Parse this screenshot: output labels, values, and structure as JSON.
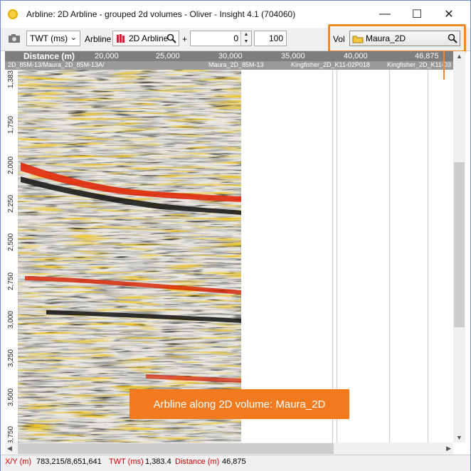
{
  "window": {
    "title": "Arbline: 2D Arbline - grouped 2d volumes - Oliver - Insight 4.1 (704060)",
    "minimize_glyph": "—",
    "maximize_glyph": "☐",
    "close_glyph": "✕"
  },
  "toolbar": {
    "domain_select": "TWT (ms)",
    "arbline_label": "Arbline",
    "arbline_value": "2D Arbline",
    "plus_label": "+",
    "offset_value": "0",
    "scale_value": "100",
    "vol_label": "Vol",
    "vol_value": "Maura_2D"
  },
  "axis": {
    "title": "Distance (m)",
    "ticks": [
      "20,000",
      "25,000",
      "30,000",
      "35,000",
      "40,000",
      "46,875"
    ]
  },
  "lines": {
    "labels": [
      "2D_85M-13/Maura_2D_85M-13A/",
      "Maura_2D_85M-13",
      "Kingfisher_2D_K11-02P018",
      "Kingfisher_2D_K11-03"
    ]
  },
  "y_axis": {
    "ticks": [
      "1,383",
      "1,750",
      "2,000",
      "2,250",
      "2,500",
      "2,750",
      "3,000",
      "3,250",
      "3,500",
      "3,750"
    ]
  },
  "status": {
    "xy_label": "X/Y (m)",
    "xy_value": "783,215/8,651,641",
    "twt_label": "TWT (ms)",
    "twt_value": "1,383.4",
    "dist_label": "Distance (m)",
    "dist_value": "46,875"
  },
  "callout": {
    "text": "Arbline along 2D volume: Maura_2D"
  },
  "colors": {
    "accent": "#f08a24",
    "callout_bg": "#f47a1f",
    "status_red": "#d00000"
  }
}
